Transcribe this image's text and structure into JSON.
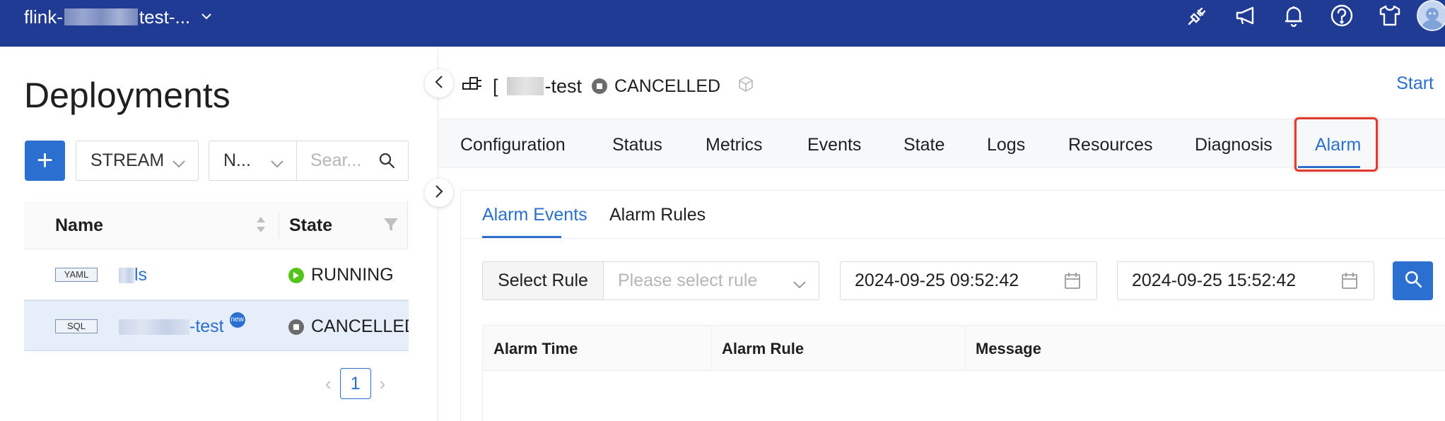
{
  "topbar": {
    "workspace_prefix": "flink-",
    "workspace_suffix": "test-...",
    "icons": [
      "plug-icon",
      "megaphone-icon",
      "bell-icon",
      "help-icon",
      "tshirt-icon",
      "avatar"
    ]
  },
  "left": {
    "title": "Deployments",
    "add_label": "+",
    "type_filter": "STREAM",
    "name_filter": "N...",
    "search_placeholder": "Sear...",
    "columns": {
      "name": "Name",
      "state": "State"
    },
    "rows": [
      {
        "type": "YAML",
        "name_suffix": "ls",
        "state": "RUNNING",
        "is_new": false
      },
      {
        "type": "SQL",
        "name_suffix": "-test",
        "state": "CANCELLED",
        "is_new": true,
        "new_label": "new"
      }
    ],
    "page": "1"
  },
  "right": {
    "job_prefix": "[",
    "job_suffix": "-test",
    "job_status": "CANCELLED",
    "start_label": "Start",
    "tabs": [
      "Configuration",
      "Status",
      "Metrics",
      "Events",
      "State",
      "Logs",
      "Resources",
      "Diagnosis",
      "Alarm"
    ],
    "active_tab": "Alarm",
    "subtabs": [
      "Alarm Events",
      "Alarm Rules"
    ],
    "active_subtab": "Alarm Events",
    "filters": {
      "rule_label": "Select Rule",
      "rule_placeholder": "Please select rule",
      "start_time": "2024-09-25 09:52:42",
      "end_time": "2024-09-25 15:52:42"
    },
    "table_columns": [
      "Alarm Time",
      "Alarm Rule",
      "Message"
    ]
  },
  "colors": {
    "topbar": "#1f3b93",
    "accent": "#2b6fd0",
    "running": "#52c41a",
    "cancelled": "#6b6b6b",
    "highlight": "#e03a31"
  }
}
